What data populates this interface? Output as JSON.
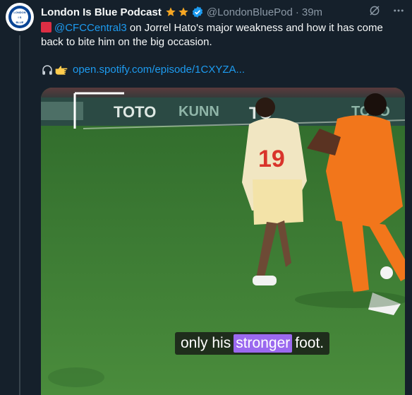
{
  "tweet": {
    "author_name": "London Is Blue Podcast",
    "handle": "@LondonBluePod",
    "separator": "·",
    "time": "39m",
    "avatar_text_top": "LONDON",
    "avatar_text_mid": "I S",
    "avatar_text_bottom": "BLUE",
    "mention": "@CFCCentral3",
    "text_after_mention": " on Jorrel Hato's major weakness and how it has come back to bite him on the big occasion.",
    "link_text": "open.spotify.com/episode/1CXYZA...",
    "icons": [
      "red-square-icon",
      "headphones-icon",
      "pointing-hand-icon",
      "grok-icon",
      "more-icon",
      "verified-icon",
      "star-icon"
    ]
  },
  "video": {
    "caption_before": "only his",
    "caption_highlight": "stronger",
    "caption_after": "foot.",
    "boards": [
      "TOTO",
      "TO",
      "KUNN",
      "TOTO"
    ],
    "jersey_number": "19",
    "colors": {
      "pitch": "#3c7a33",
      "orange": "#f2761b",
      "highlight": "#9b69ef",
      "accent": "#1d9bf0"
    }
  }
}
